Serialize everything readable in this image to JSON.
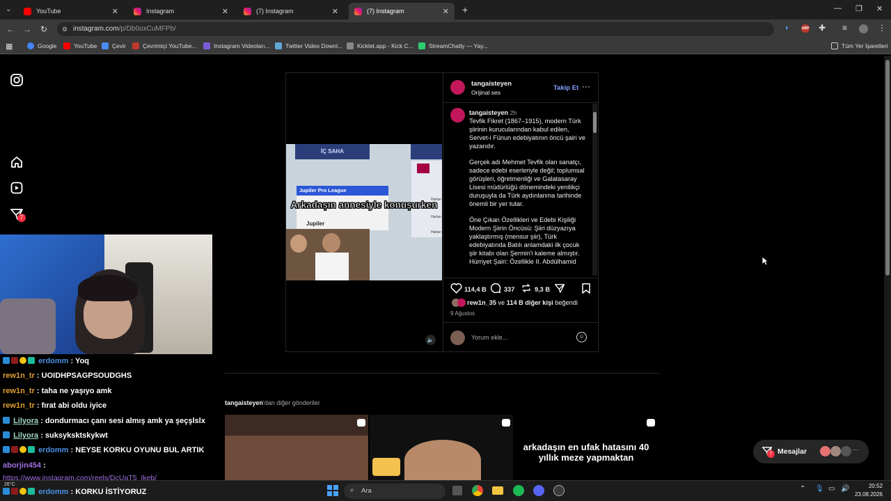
{
  "tabs": [
    {
      "title": "YouTube",
      "icon": "youtube-icon"
    },
    {
      "title": "Instagram",
      "icon": "instagram-icon"
    },
    {
      "title": "(7) Instagram",
      "icon": "instagram-icon"
    },
    {
      "title": "(7) Instagram",
      "icon": "instagram-icon"
    }
  ],
  "address": {
    "host": "instagram.com",
    "path": "/p/Db0oxCuMFPb/"
  },
  "bookmarks": [
    "Google",
    "YouTube",
    "Çevir",
    "Çevrimiçi YouTube...",
    "Instagram Videoları...",
    "Twitter Video Downl...",
    "Kicklet.app - Kick C...",
    "StreamChatly — Yay..."
  ],
  "bookmarks_all": "Tüm Yer İşaretleri",
  "post": {
    "username": "tangaisteyen",
    "audio": "Orijinal ses",
    "follow": "Takip Et",
    "caption_user": "tangaisteyen",
    "caption_time": "2h",
    "caption_p1": "Tevfik Fikret (1867–1915), modern Türk şiirinin kurucularından kabul edilen, Servet-i Fünun edebiyatının öncü şairi ve yazarıdır.",
    "caption_p2": "Gerçek adı Mehmet Tevfik olan sanatçı, sadece edebi eserleriyle değil; toplumsal görüşleri, öğretmenliği ve Galatasaray Lisesi müdürlüğü dönemindeki yenilikçi duruşuyla da Türk aydınlanma tarihinde önemli bir yer tutar.",
    "caption_p3": "Öne Çıkan Özellikleri ve Edebi Kişiliği Modern Şiirin Öncüsü: Şiiri düzyazıya yaklaştırmış (mensur şiir), Türk edebiyatında Batılı anlamdaki ilk çocuk şiir kitabı olan Şermin'i kaleme almıştır. Hürriyet Şairi: Özellikle II. Abdülhamid",
    "likes": "114,4 B",
    "comments": "337",
    "reposts": "9,3 B",
    "liked_by_user": "rew1n_35",
    "liked_by_and": "ve",
    "liked_by_rest": "114 B diğer kişi",
    "liked_by_suffix": "beğendi",
    "date": "9 Ağustos",
    "comment_placeholder": "Yorum ekle...",
    "video_header_left": "İÇ SAHA",
    "video_league": "Jupiler Pro League",
    "video_caption": "Arkadaşın annesiyle konuşurken",
    "video_brand": "Jupiler",
    "video_side_rows": [
      "Harlan",
      "Harlan",
      "Harlan"
    ]
  },
  "more_posts": {
    "user": "tangaisteyen",
    "suffix": "'dan diğer gönderiler",
    "thumb3_text": "arkadaşın en ufak hatasını 40 yıllık meze yapmaktan"
  },
  "messages": {
    "label": "Mesajlar",
    "badge": "7"
  },
  "sidebar_badge": "7",
  "chat": [
    {
      "user": "erdomm",
      "color": "#4a90e2",
      "msg": "Yoq",
      "badges": true
    },
    {
      "user": "rew1n_tr",
      "color": "#e0a030",
      "msg": "UOIDHPSAGPSOUDGHS",
      "badges": false
    },
    {
      "user": "rew1n_tr",
      "color": "#e0a030",
      "msg": "taha ne yaşıyo amk",
      "badges": false
    },
    {
      "user": "rew1n_tr",
      "color": "#e0a030",
      "msg": "fırat abi oldu iyice",
      "badges": false
    },
    {
      "user": "Lilyora",
      "color": "#a0d8c0",
      "msg": "dondurmacı çanı sesi almış amk ya şeçşlslx",
      "badges": true
    },
    {
      "user": "Lilyora",
      "color": "#a0d8c0",
      "msg": "suksyksktskykwt",
      "badges": true
    },
    {
      "user": "erdomm",
      "color": "#4a90e2",
      "msg": "NEYSE KORKU OYUNU BUL ARTIK",
      "badges": true
    },
    {
      "user": "aborjin454",
      "color": "#a070e0",
      "msg": "",
      "badges": false
    },
    {
      "user": "",
      "color": "#a070e0",
      "msg": "https://www.instagram.com/reels/DcUaT5_Ikeb/",
      "badges": false
    },
    {
      "user": "erdomm",
      "color": "#4a90e2",
      "msg": "KORKU İSTİYORUZ",
      "badges": true
    }
  ],
  "taskbar": {
    "search": "Ara",
    "weather": "26°C",
    "time": "20:52",
    "date": "23.08.2026"
  }
}
